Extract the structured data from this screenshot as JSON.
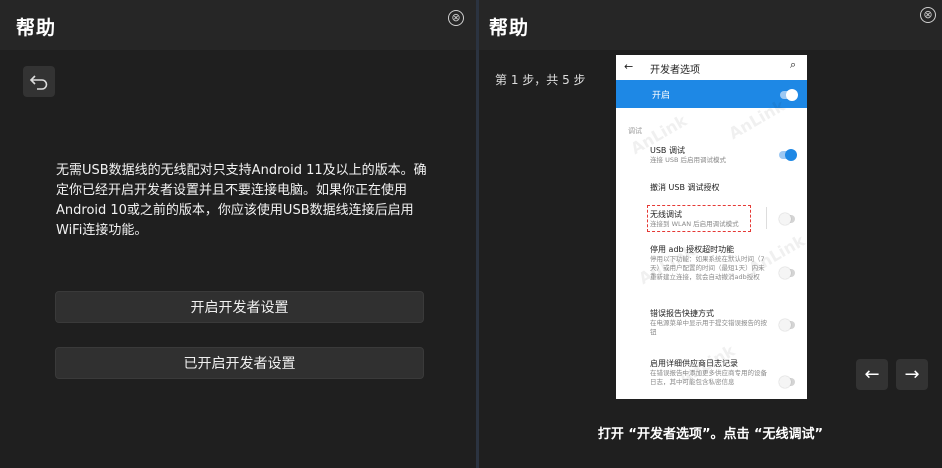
{
  "left": {
    "title": "帮助",
    "close_glyph": "⊗",
    "description": "无需USB数据线的无线配对只支持Android 11及以上的版本。确定你已经开启开发者设置并且不要连接电脑。如果你正在使用Android 10或之前的版本，你应该使用USB数据线连接后启用WiFi连接功能。",
    "button_open": "开启开发者设置",
    "button_opened": "已开启开发者设置"
  },
  "right": {
    "title": "帮助",
    "close_glyph": "⊗",
    "step_text": "第 1 步，共 5 步",
    "caption": "打开 “开发者选项”。点击 “无线调试”",
    "prev_glyph": "←",
    "next_glyph": "→"
  },
  "phone": {
    "back_glyph": "←",
    "title": "开发者选项",
    "search_glyph": "⌕",
    "toggle_label": "开启",
    "category": "调试",
    "rows": [
      {
        "title": "USB 调试",
        "subtitle": "连接 USB 后启用调试模式"
      },
      {
        "title": "撤消 USB 调试授权",
        "subtitle": ""
      },
      {
        "title": "无线调试",
        "subtitle": "连接到 WLAN 后启用调试模式"
      },
      {
        "title": "停用 adb 授权超时功能",
        "subtitle": "停用以下功能：如果系统在默认时间（7天）或用户配置的时间（最短1天）内未重新建立连接，就会自动撤消adb授权"
      },
      {
        "title": "错误报告快捷方式",
        "subtitle": "在电源菜单中显示用于提交错误报告的按钮"
      },
      {
        "title": "启用详细供应商日志记录",
        "subtitle": "在错误报告中添加更多供应商专用的设备日志，其中可能包含私密信息"
      }
    ],
    "watermark": "AnLink"
  },
  "colors": {
    "accent": "#1e88e5",
    "panel_bg": "#1f1f1f",
    "titlebar_bg": "#262626",
    "button_bg": "#303030",
    "highlight": "#e53935"
  },
  "icons": {
    "back": "undo-arrow-icon",
    "close": "close-circle-icon",
    "prev": "arrow-left-icon",
    "next": "arrow-right-icon"
  }
}
